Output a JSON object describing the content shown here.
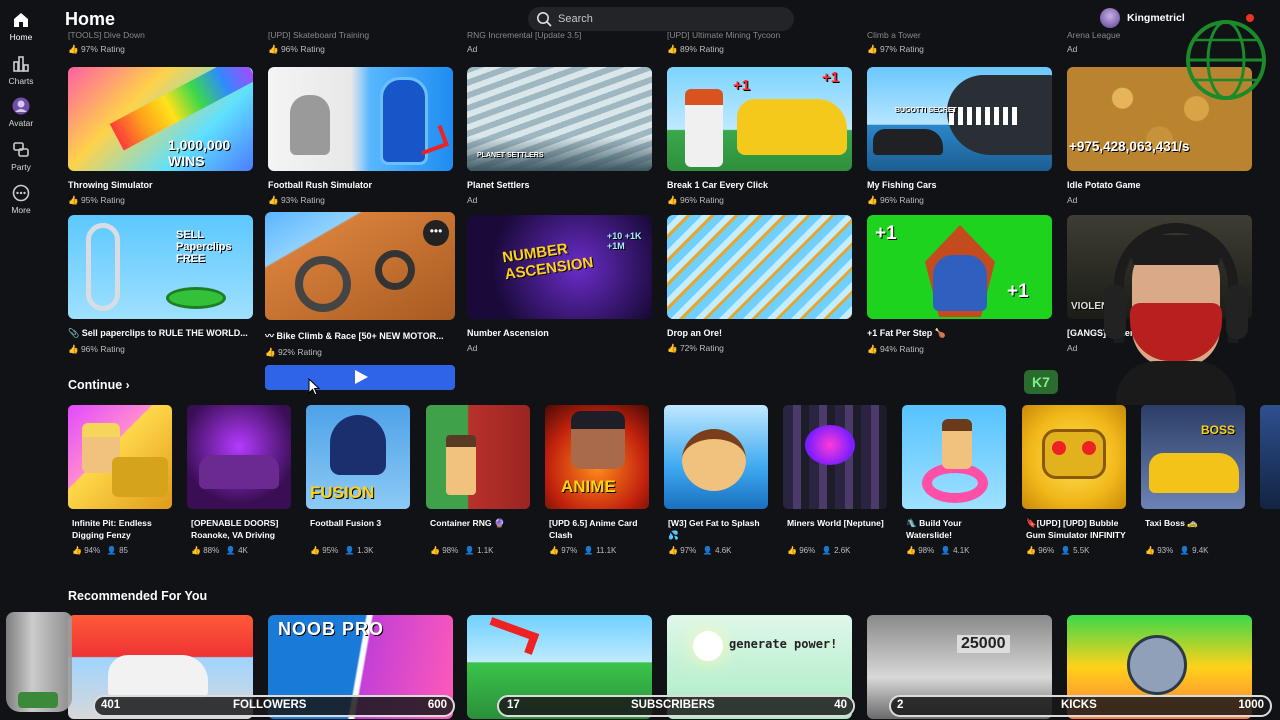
{
  "header": {
    "title": "Home",
    "search_placeholder": "Search",
    "username": "Kingmetricl"
  },
  "sidebar": {
    "items": [
      {
        "label": "Home"
      },
      {
        "label": "Charts"
      },
      {
        "label": "Avatar"
      },
      {
        "label": "Party"
      },
      {
        "label": "More"
      }
    ]
  },
  "top_strip": [
    {
      "title": "[TOOLS] Dive Down",
      "sub": "97% Rating"
    },
    {
      "title": "[UPD] Skateboard Training",
      "sub": "96% Rating"
    },
    {
      "title": "RNG Incremental [Update 3.5]",
      "sub": "Ad"
    },
    {
      "title": "[UPD] Ultimate Mining Tycoon",
      "sub": "89% Rating"
    },
    {
      "title": "Climb a Tower",
      "sub": "97% Rating"
    },
    {
      "title": "Arena League",
      "sub": "Ad"
    }
  ],
  "row1": [
    {
      "title": "Throwing Simulator",
      "sub": "95% Rating",
      "art": "1,000,000 WINS"
    },
    {
      "title": "Football Rush Simulator",
      "sub": "93% Rating",
      "art": ""
    },
    {
      "title": "Planet Settlers",
      "sub": "Ad",
      "art": "PLANET SETTLERS"
    },
    {
      "title": "Break 1 Car Every Click",
      "sub": "96% Rating",
      "art": "+1"
    },
    {
      "title": "My Fishing Cars",
      "sub": "96% Rating",
      "art": "BUGOTTI SECRET"
    },
    {
      "title": "Idle Potato Game",
      "sub": "Ad",
      "art": "+975,428,063,431/s"
    }
  ],
  "row2": [
    {
      "title": "Sell paperclips to RULE THE WORLD...",
      "sub": "96% Rating",
      "art": "SELL Paperclips FREE"
    },
    {
      "title": "Bike Climb & Race [50+ NEW MOTOR...",
      "sub": "92% Rating",
      "art": ""
    },
    {
      "title": "Number Ascension",
      "sub": "Ad",
      "art": "NUMBER ASCENSION"
    },
    {
      "title": "Drop an Ore!",
      "sub": "72% Rating",
      "art": ""
    },
    {
      "title": "+1 Fat Per Step",
      "sub": "94% Rating",
      "art": "+1"
    },
    {
      "title": "[GANGS] Violence District",
      "sub": "Ad",
      "art": "VIOLENCE"
    }
  ],
  "continue": {
    "title": "Continue",
    "items": [
      {
        "title": "Infinite Pit: Endless Digging Fenzy",
        "rating": "94%",
        "players": "85"
      },
      {
        "title": "[OPENABLE DOORS] Roanoke, VA Driving",
        "rating": "88%",
        "players": "4K"
      },
      {
        "title": "Football Fusion 3",
        "rating": "95%",
        "players": "1.3K"
      },
      {
        "title": "Container RNG",
        "rating": "98%",
        "players": "1.1K"
      },
      {
        "title": "[UPD 6.5] Anime Card Clash",
        "rating": "97%",
        "players": "11.1K"
      },
      {
        "title": "[W3] Get Fat to Splash",
        "rating": "97%",
        "players": "4.6K"
      },
      {
        "title": "Miners World [Neptune]",
        "rating": "96%",
        "players": "2.6K"
      },
      {
        "title": "Build Your Waterslide!",
        "rating": "98%",
        "players": "4.1K"
      },
      {
        "title": "[UPD] Bubble Gum Simulator INFINITY",
        "rating": "96%",
        "players": "5.5K"
      },
      {
        "title": "Taxi Boss",
        "rating": "93%",
        "players": "9.4K"
      }
    ]
  },
  "continue_art": {
    "c3": "FUSION",
    "c5": "ANIME",
    "c10": "BOSS"
  },
  "recommended": {
    "title": "Recommended For You",
    "items": [
      {
        "art": ""
      },
      {
        "art": "NOOB PRO"
      },
      {
        "art": ""
      },
      {
        "art": "generate power!"
      },
      {
        "art": "25000"
      },
      {
        "art": ""
      }
    ]
  },
  "overlay": {
    "followers": {
      "count": "401",
      "label": "FOLLOWERS",
      "goal": "600"
    },
    "subscribers": {
      "count": "17",
      "label": "SUBSCRIBERS",
      "goal": "40"
    },
    "kicks": {
      "count": "2",
      "label": "KICKS",
      "goal": "1000"
    },
    "badge": "K7"
  },
  "colors": {
    "background": "#111216",
    "accent": "#2f64e9",
    "text_muted": "#bdbdbd"
  }
}
